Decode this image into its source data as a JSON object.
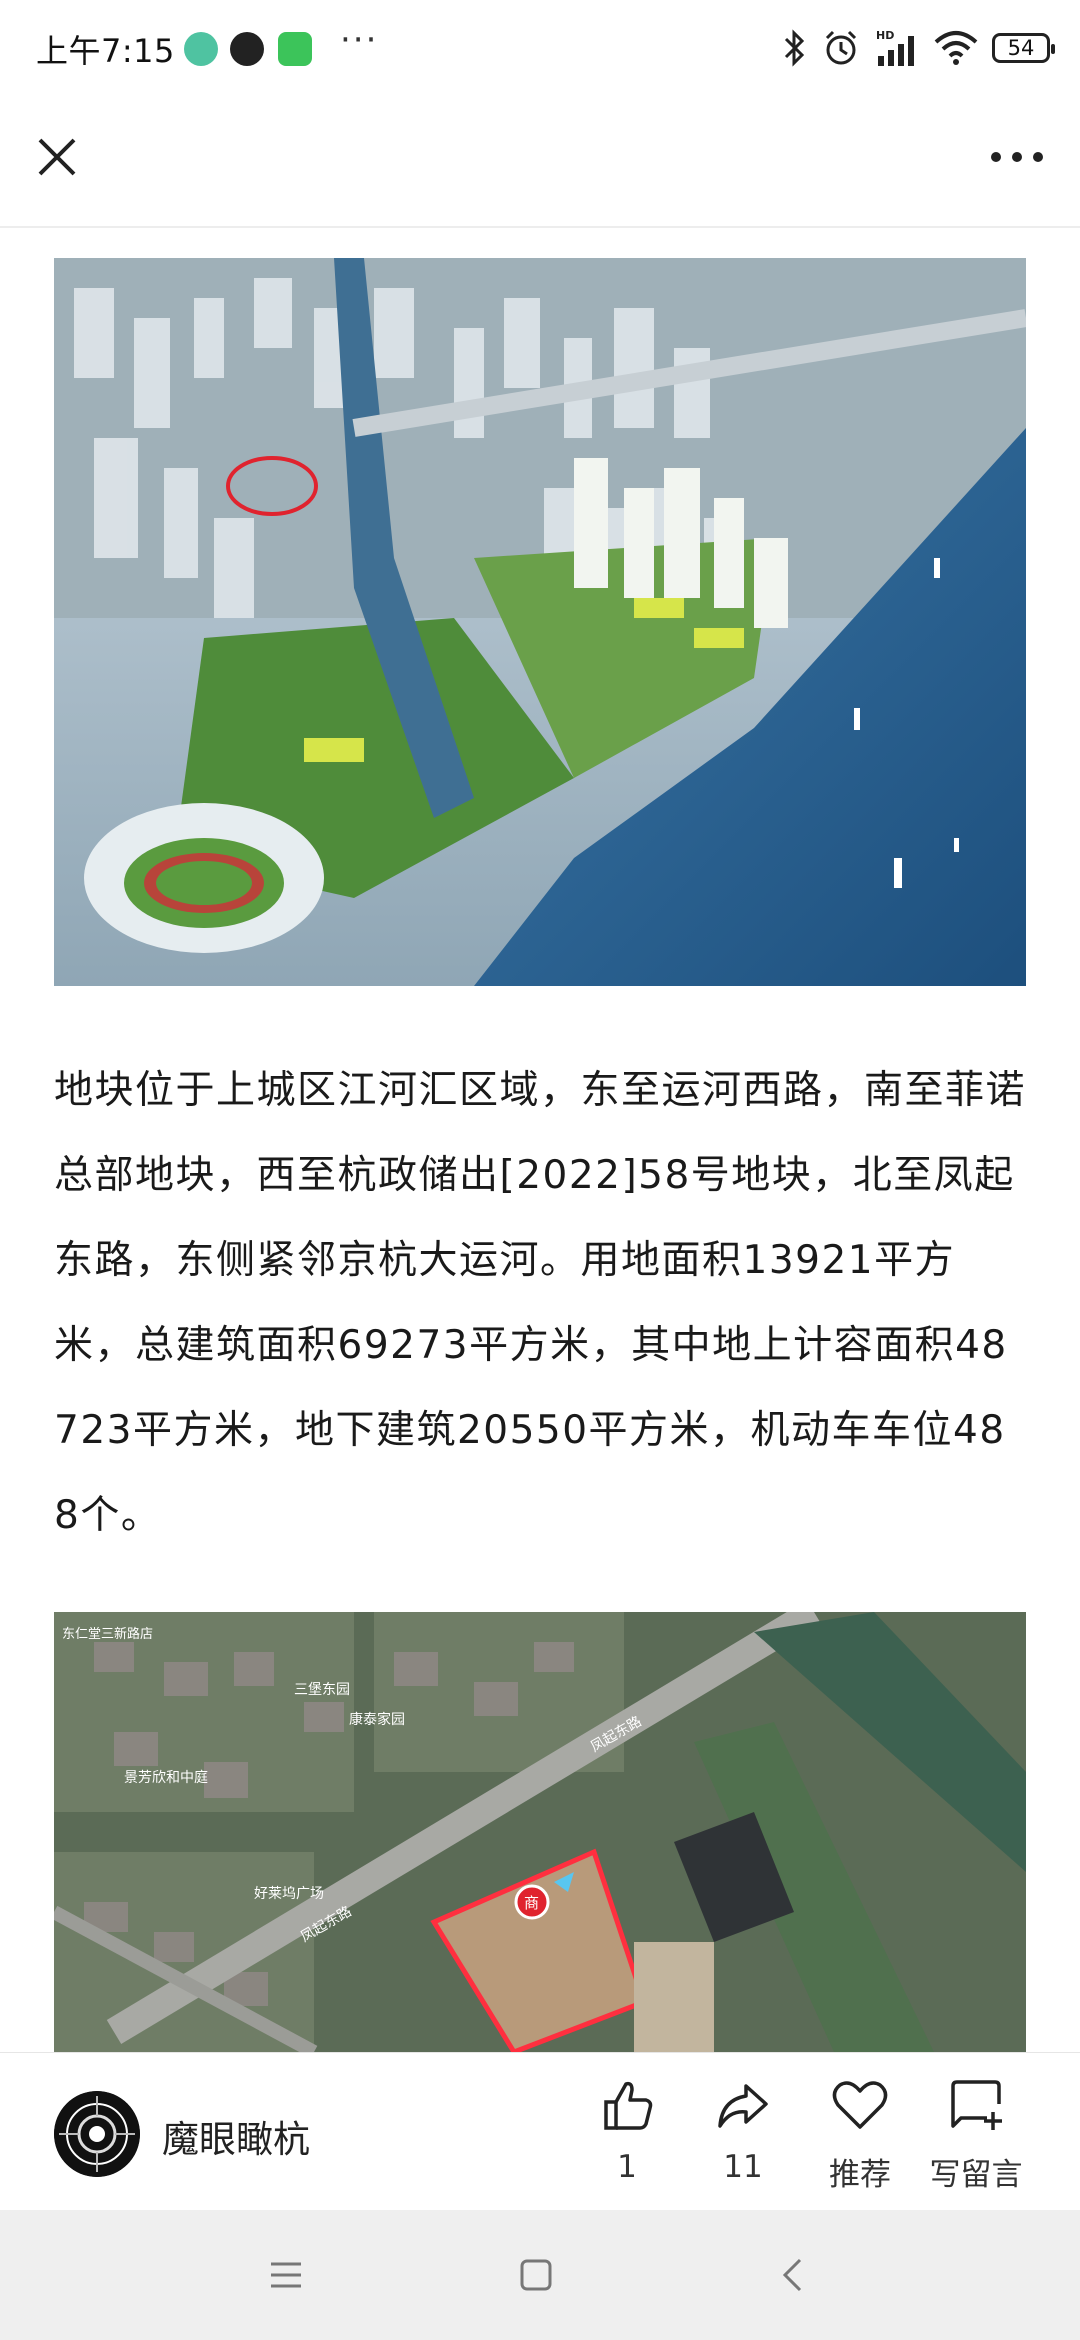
{
  "status_bar": {
    "time": "上午7:15",
    "more": "···",
    "battery": "54",
    "icons": [
      "app-notification-icon",
      "dark-app-icon",
      "green-app-icon",
      "bluetooth-icon",
      "alarm-icon",
      "hd-signal-icon",
      "wifi-icon",
      "battery-icon"
    ]
  },
  "nav": {
    "close_icon": "close-icon",
    "more_icon": "more-horizontal-icon"
  },
  "article": {
    "paragraph": "地块位于上城区江河汇区域，东至运河西路，南至菲诺总部地块，西至杭政储出[2022]58号地块，北至凤起东路，东侧紧邻京杭大运河。用地面积13921平方米，总建筑面积69273平方米，其中地上计容面积48723平方米，地下建筑20550平方米，机动车车位488个。",
    "map_labels": {
      "poi1": "东仁堂三新路店",
      "poi2": "三堡东园",
      "poi3": "康泰家园",
      "poi4": "景芳欣和中庭",
      "poi5": "好莱坞广场",
      "road1": "凤起东路",
      "road2": "凤起东路",
      "pin": "商"
    }
  },
  "action_bar": {
    "author": "魔眼瞰杭",
    "like_count": "1",
    "share_count": "11",
    "recommend_label": "推荐",
    "comment_label": "写留言"
  },
  "colors": {
    "accent": "#e53935",
    "text": "#1a1a1a",
    "divider": "#ededed",
    "sys_nav_bg": "#efefef"
  }
}
